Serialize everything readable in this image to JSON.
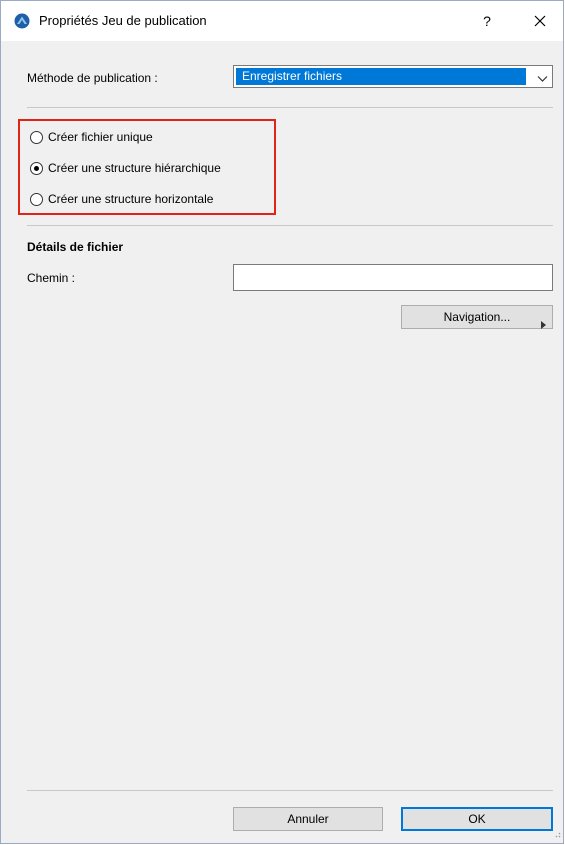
{
  "titlebar": {
    "title": "Propriétés Jeu de publication",
    "help_label": "?",
    "app_icon": "archicad-icon"
  },
  "method": {
    "label": "Méthode de publication :",
    "selected_value": "Enregistrer fichiers"
  },
  "structure_options": [
    {
      "label": "Créer fichier unique",
      "checked": false
    },
    {
      "label": "Créer une structure hiérarchique",
      "checked": true
    },
    {
      "label": "Créer une structure horizontale",
      "checked": false
    }
  ],
  "file_details": {
    "heading": "Détails de fichier",
    "path_label": "Chemin :",
    "path_value": "",
    "browse_label": "Navigation..."
  },
  "footer": {
    "cancel_label": "Annuler",
    "ok_label": "OK"
  },
  "colors": {
    "accent": "#0078d7",
    "highlight_border": "#e2231a"
  }
}
